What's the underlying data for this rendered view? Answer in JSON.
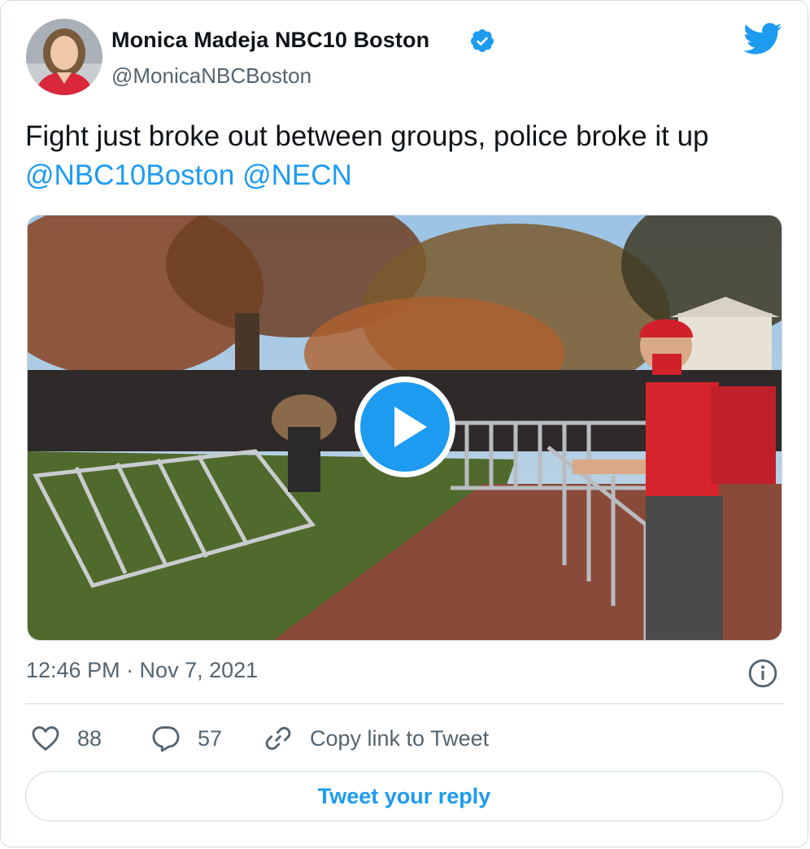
{
  "tweet": {
    "author_name": "Monica Madeja NBC10 Boston",
    "author_handle": "@MonicaNBCBoston",
    "text_prefix": "Fight just broke out between groups, police broke it up ",
    "mention_1": "@NBC10Boston",
    "mention_2": "@NECN",
    "timestamp": "12:46 PM · Nov 7, 2021"
  },
  "actions": {
    "likes": "88",
    "replies": "57",
    "copy_link_label": "Copy link to Tweet",
    "reply_button_label": "Tweet your reply"
  },
  "colors": {
    "accent": "#1d9bf0",
    "secondary_text": "#536471",
    "border": "#cfd9de"
  },
  "icons": {
    "verified": "verified-badge-icon",
    "logo": "twitter-bird-icon",
    "play": "play-icon",
    "info": "info-icon",
    "like": "heart-icon",
    "reply": "speech-bubble-icon",
    "link": "link-icon"
  }
}
